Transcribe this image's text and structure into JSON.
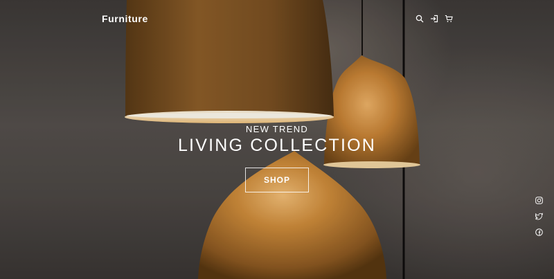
{
  "header": {
    "brand": "Furniture",
    "icons": [
      "search-icon",
      "login-icon",
      "cart-icon"
    ]
  },
  "hero": {
    "eyebrow": "NEW TREND",
    "headline": "LIVING COLLECTION",
    "cta_label": "SHOP"
  },
  "social": {
    "icons": [
      "instagram-icon",
      "twitter-icon",
      "facebook-icon"
    ]
  },
  "colors": {
    "text": "#ffffff",
    "lamp_copper": "#b87a35",
    "background": "#4a4542"
  }
}
